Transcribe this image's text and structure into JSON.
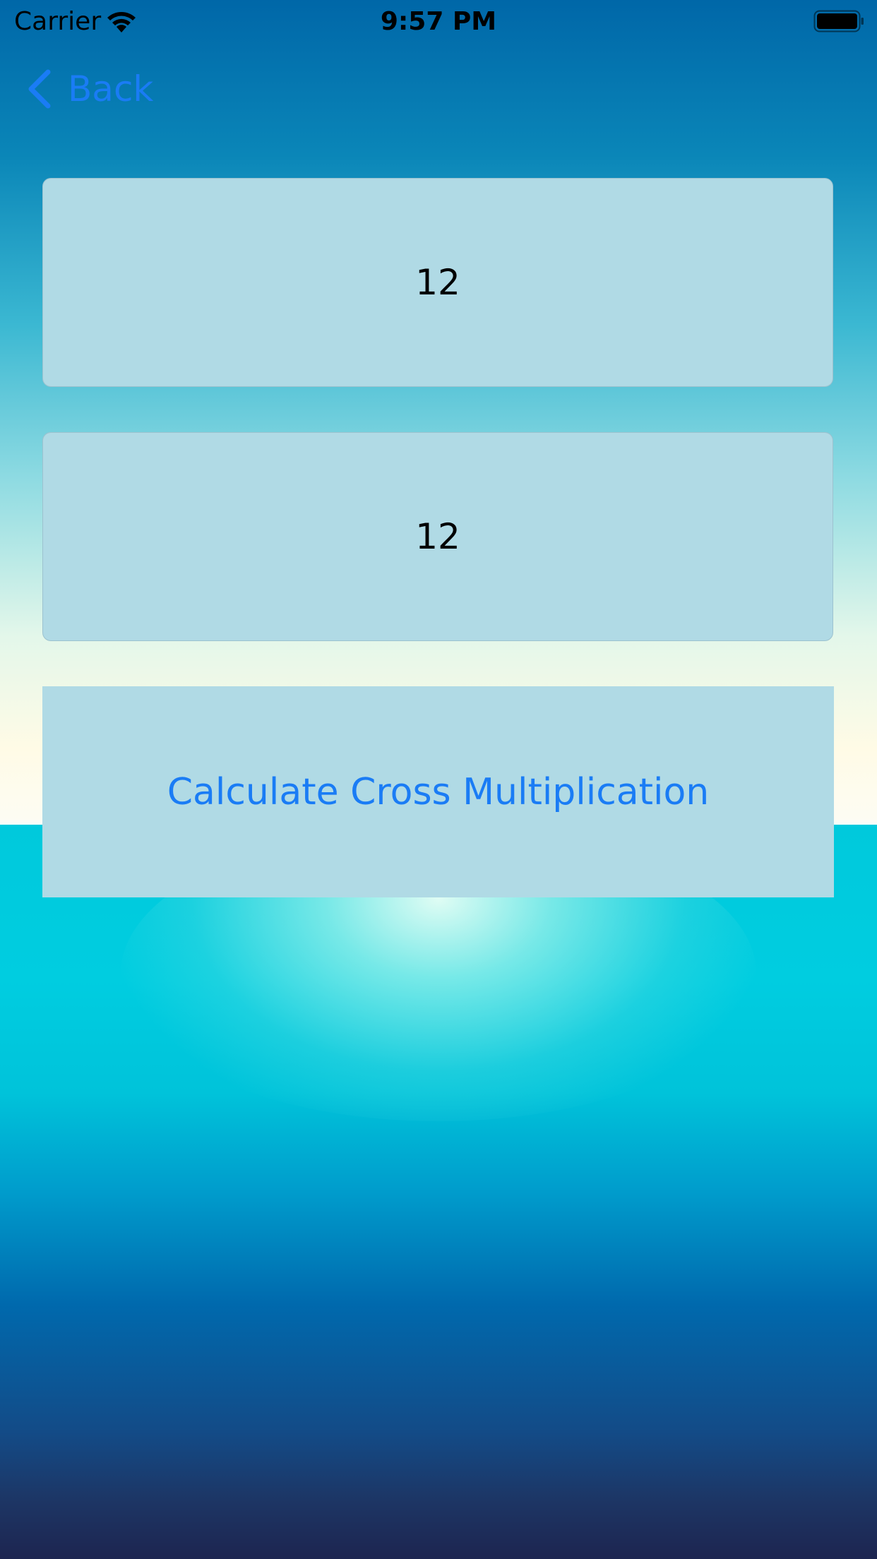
{
  "status_bar": {
    "carrier": "Carrier",
    "time": "9:57 PM"
  },
  "nav": {
    "back_label": "Back"
  },
  "form": {
    "first_value": "12",
    "second_value": "12",
    "calculate_label": "Calculate Cross Multiplication"
  },
  "colors": {
    "accent": "#1a7cf5",
    "field_background": "#b0dae5"
  },
  "icons": {
    "wifi": "wifi-icon",
    "battery": "battery-icon",
    "back": "chevron-left-icon"
  }
}
